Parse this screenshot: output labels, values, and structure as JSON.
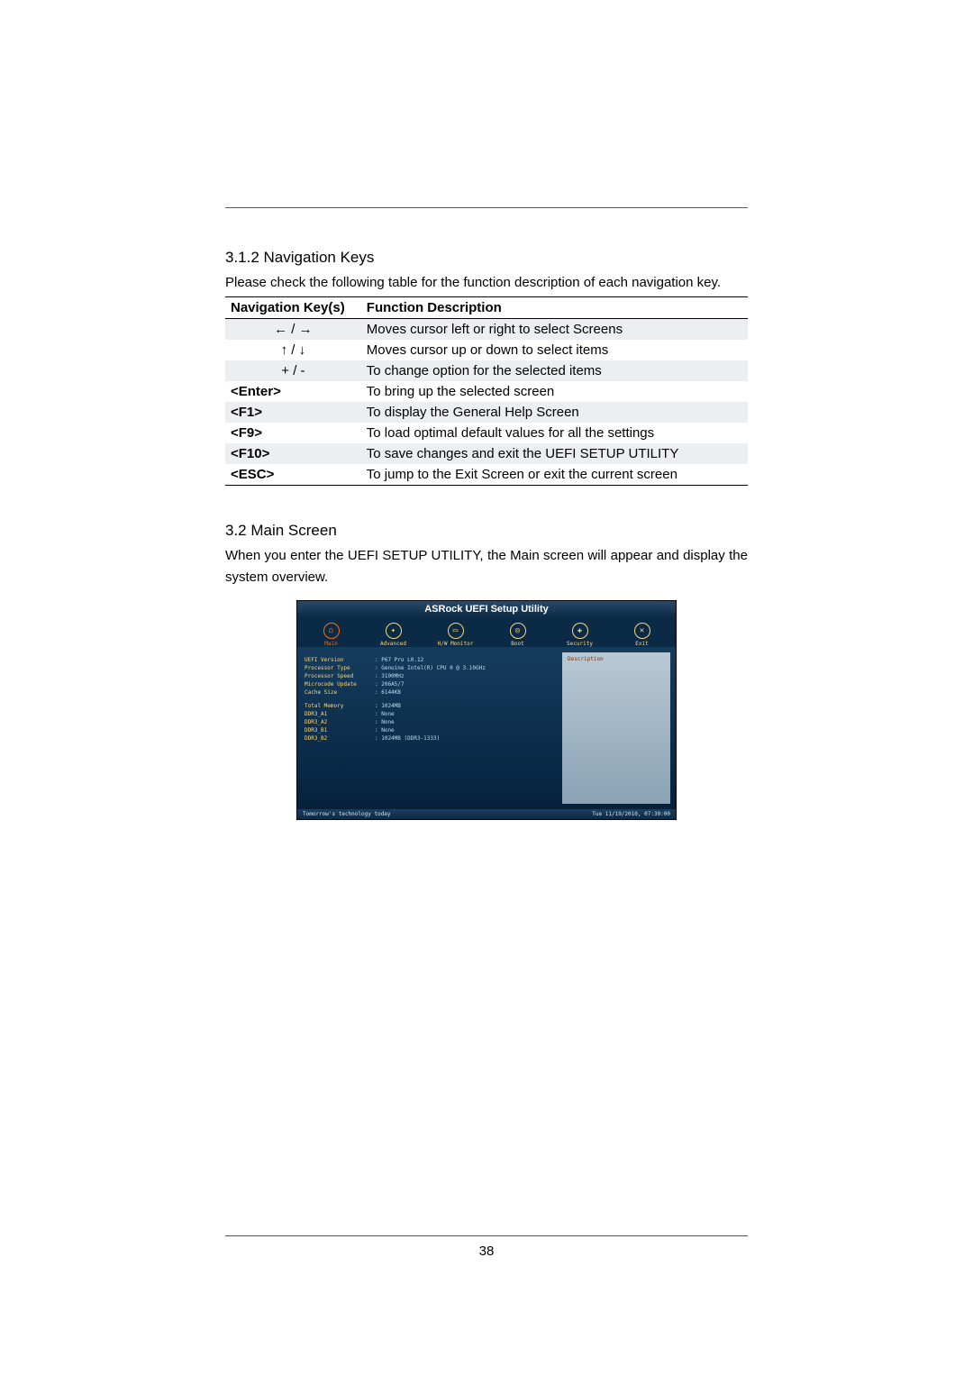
{
  "section312": {
    "heading": "3.1.2  Navigation Keys",
    "intro": "Please check the following table for the function description of each navigation key.",
    "col1": "Navigation Key(s)",
    "col2": "Function Description",
    "rows": [
      {
        "key_sym": "lr",
        "desc": "Moves cursor left or right to select Screens"
      },
      {
        "key_sym": "ud",
        "desc": "Moves cursor up or down to select items"
      },
      {
        "key": "+  /  -",
        "desc": "To change option for the selected items"
      },
      {
        "key": "<Enter>",
        "desc": "To bring up the selected screen"
      },
      {
        "key": "<F1>",
        "desc": "To display the General Help Screen"
      },
      {
        "key": "<F9>",
        "desc": "To load optimal default values for all the settings"
      },
      {
        "key": "<F10>",
        "desc": "To save changes and exit the UEFI SETUP UTILITY"
      },
      {
        "key": "<ESC>",
        "desc": "To jump to the Exit Screen or exit the current screen"
      }
    ]
  },
  "section32": {
    "heading": "3.2  Main Screen",
    "intro": "When you enter the UEFI SETUP UTILITY, the Main screen will appear and display the system overview."
  },
  "bios": {
    "title": "ASRock UEFI Setup Utility",
    "tabs": [
      "Main",
      "Advanced",
      "H/W Monitor",
      "Boot",
      "Security",
      "Exit"
    ],
    "fields": [
      {
        "label": "UEFI Version",
        "value": ": P67 Pro L0.12"
      },
      {
        "label": "Processor Type",
        "value": ": Genuine Intel(R) CPU 0 @ 3.10GHz"
      },
      {
        "label": "Processor Speed",
        "value": ": 3100MHz"
      },
      {
        "label": "Microcode Update",
        "value": ": 206A5/7"
      },
      {
        "label": "Cache Size",
        "value": ": 6144KB"
      }
    ],
    "mem": [
      {
        "label": "Total Memory",
        "value": ": 1024MB"
      },
      {
        "label": "DDR3_A1",
        "value": ": None"
      },
      {
        "label": "DDR3_A2",
        "value": ": None"
      },
      {
        "label": "DDR3_B1",
        "value": ": None"
      },
      {
        "label": "DDR3_B2",
        "value": ": 1024MB (DDR3-1333)"
      }
    ],
    "right_label": "Description",
    "footer_left": "Tomorrow's technology today",
    "footer_right": "Tue 11/19/2010, 07:30:00"
  },
  "page_number": "38"
}
